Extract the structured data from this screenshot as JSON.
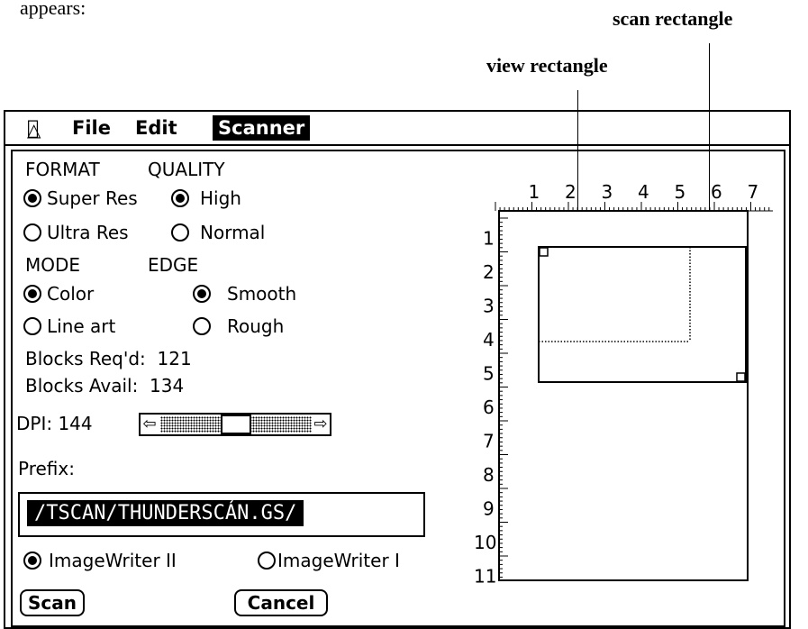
{
  "doc": {
    "text": "appears:"
  },
  "callouts": {
    "scan": "scan rectangle",
    "view": "view rectangle"
  },
  "menubar": {
    "apple_icon": "apple-icon",
    "items": [
      {
        "label": "File",
        "selected": false
      },
      {
        "label": "Edit",
        "selected": false
      },
      {
        "label": "Scanner",
        "selected": true
      }
    ]
  },
  "scanner": {
    "format": {
      "label": "FORMAT",
      "options": [
        {
          "label": "Super Res",
          "checked": true
        },
        {
          "label": "Ultra Res",
          "checked": false
        }
      ]
    },
    "quality": {
      "label": "QUALITY",
      "options": [
        {
          "label": "High",
          "checked": true
        },
        {
          "label": "Normal",
          "checked": false
        }
      ]
    },
    "mode": {
      "label": "MODE",
      "options": [
        {
          "label": "Color",
          "checked": true
        },
        {
          "label": "Line art",
          "checked": false
        }
      ]
    },
    "edge": {
      "label": "EDGE",
      "options": [
        {
          "label": "Smooth",
          "checked": true
        },
        {
          "label": "Rough",
          "checked": false
        }
      ]
    },
    "blocks_reqd": "Blocks Req'd:  121",
    "blocks_avail": "Blocks Avail:  134",
    "dpi": {
      "label": "DPI: 144",
      "left_arrow": "⇦",
      "right_arrow": "⇨",
      "position": 0.5
    },
    "prefix": {
      "label": "Prefix:",
      "value": "/TSCAN/THUNDERSCÁN.GS/"
    },
    "printers": [
      {
        "label": "ImageWriter II",
        "checked": true
      },
      {
        "label": "ImageWriter I",
        "checked": false
      }
    ],
    "scan_button": "Scan",
    "cancel_button": "Cancel"
  },
  "ruler": {
    "top_labels": [
      "1",
      "2",
      "3",
      "4",
      "5",
      "6",
      "7"
    ],
    "left_labels": [
      "1",
      "2",
      "3",
      "4",
      "5",
      "6",
      "7",
      "8",
      "9",
      "10",
      "11"
    ]
  }
}
